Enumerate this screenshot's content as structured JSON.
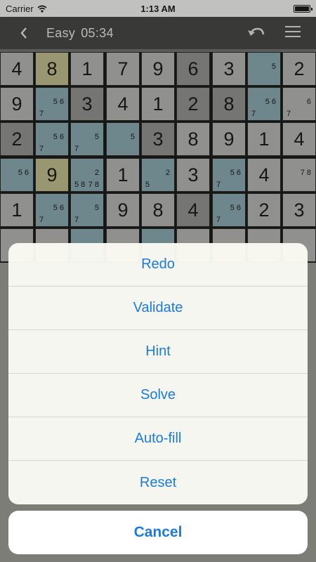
{
  "status_bar": {
    "carrier": "Carrier",
    "time": "1:13 AM"
  },
  "nav": {
    "difficulty": "Easy",
    "timer": "05:34"
  },
  "board": {
    "rows": [
      [
        "4",
        "8",
        "1",
        "7",
        "9",
        "6",
        "3",
        "",
        "2"
      ],
      [
        "9",
        "",
        "3",
        "4",
        "1",
        "2",
        "8",
        "",
        ""
      ],
      [
        "2",
        "",
        "",
        "",
        "3",
        "8",
        "9",
        "1",
        "4"
      ],
      [
        "",
        "9",
        "",
        "1",
        "",
        "3",
        "",
        "4",
        ""
      ],
      [
        "1",
        "",
        "",
        "9",
        "8",
        "4",
        "",
        "2",
        "3"
      ]
    ],
    "notes": [
      {
        "r": 0,
        "c": 7,
        "v": "5"
      },
      {
        "r": 1,
        "c": 1,
        "v": "5 6"
      },
      {
        "r": 1,
        "c": 1,
        "v": "7"
      },
      {
        "r": 1,
        "c": 7,
        "v": "5 6"
      },
      {
        "r": 1,
        "c": 7,
        "v": "7"
      },
      {
        "r": 1,
        "c": 8,
        "v": "6"
      },
      {
        "r": 1,
        "c": 8,
        "v": "7"
      },
      {
        "r": 2,
        "c": 1,
        "v": "5 6"
      },
      {
        "r": 2,
        "c": 1,
        "v": "7"
      },
      {
        "r": 2,
        "c": 2,
        "v": "5"
      },
      {
        "r": 2,
        "c": 2,
        "v": "7"
      },
      {
        "r": 2,
        "c": 3,
        "v": "5"
      },
      {
        "r": 3,
        "c": 0,
        "v": "5 6"
      },
      {
        "r": 3,
        "c": 2,
        "v": "2"
      },
      {
        "r": 3,
        "c": 2,
        "v": "5 8"
      },
      {
        "r": 3,
        "c": 2,
        "v": "7 8"
      },
      {
        "r": 3,
        "c": 4,
        "v": "2"
      },
      {
        "r": 3,
        "c": 4,
        "v": "5"
      },
      {
        "r": 3,
        "c": 6,
        "v": "5 6"
      },
      {
        "r": 3,
        "c": 6,
        "v": "7"
      },
      {
        "r": 3,
        "c": 8,
        "v": "7 8"
      },
      {
        "r": 4,
        "c": 1,
        "v": "5 6"
      },
      {
        "r": 4,
        "c": 1,
        "v": "7"
      },
      {
        "r": 4,
        "c": 2,
        "v": "5"
      },
      {
        "r": 4,
        "c": 2,
        "v": "7"
      },
      {
        "r": 4,
        "c": 6,
        "v": "5 6"
      },
      {
        "r": 4,
        "c": 6,
        "v": "7"
      }
    ]
  },
  "action_sheet": {
    "items": [
      "Redo",
      "Validate",
      "Hint",
      "Solve",
      "Auto-fill",
      "Reset"
    ],
    "cancel": "Cancel"
  }
}
